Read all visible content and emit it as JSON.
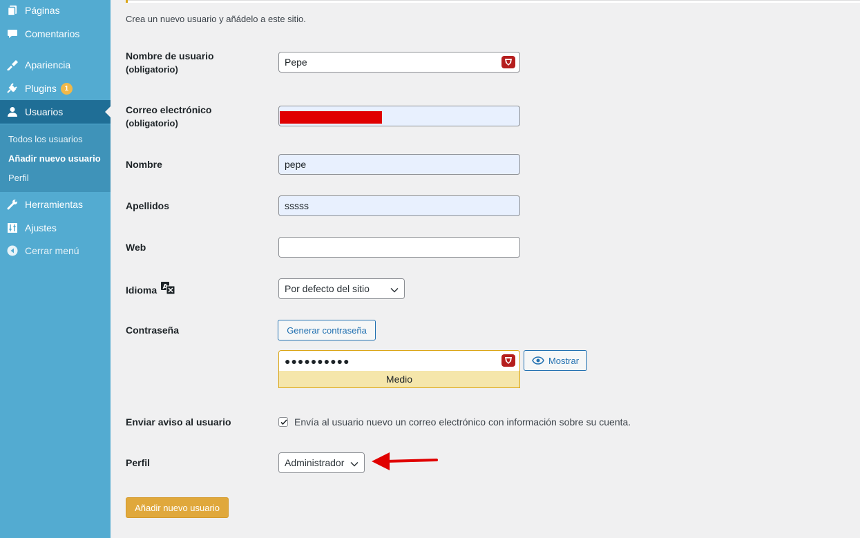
{
  "sidebar": {
    "items": [
      {
        "label": "Páginas",
        "icon": "pages-icon"
      },
      {
        "label": "Comentarios",
        "icon": "comments-icon"
      },
      {
        "label": "Apariencia",
        "icon": "appearance-icon"
      },
      {
        "label": "Plugins",
        "icon": "plugins-icon",
        "badge": "1"
      },
      {
        "label": "Usuarios",
        "icon": "users-icon"
      },
      {
        "label": "Herramientas",
        "icon": "tools-icon"
      },
      {
        "label": "Ajustes",
        "icon": "settings-icon"
      },
      {
        "label": "Cerrar menú",
        "icon": "collapse-icon"
      }
    ],
    "submenu": [
      "Todos los usuarios",
      "Añadir nuevo usuario",
      "Perfil"
    ],
    "colors": {
      "background": "#53abd1",
      "current": "#1f6e96",
      "submenu": "#3f93b9",
      "badge": "#f0b849"
    }
  },
  "form": {
    "intro": "Crea un nuevo usuario y añádelo a este sitio.",
    "username": {
      "label": "Nombre de usuario",
      "required": "(obligatorio)",
      "value": "Pepe"
    },
    "email": {
      "label": "Correo electrónico",
      "required": "(obligatorio)",
      "value": ""
    },
    "first_name": {
      "label": "Nombre",
      "value": "pepe"
    },
    "last_name": {
      "label": "Apellidos",
      "value": "sssss"
    },
    "website": {
      "label": "Web",
      "value": ""
    },
    "language": {
      "label": "Idioma",
      "value": "Por defecto del sitio"
    },
    "password": {
      "label": "Contraseña",
      "generate_button": "Generar contraseña",
      "value": "●●●●●●●●●●",
      "show_button": "Mostrar",
      "strength": "Medio"
    },
    "notify": {
      "label": "Enviar aviso al usuario",
      "checked": true,
      "text": "Envía al usuario nuevo un correo electrónico con información sobre su cuenta."
    },
    "role": {
      "label": "Perfil",
      "value": "Administrador"
    },
    "submit": "Añadir nuevo usuario"
  },
  "colors": {
    "primary_button": "#e0a83c",
    "link": "#2271b1",
    "strength_bg": "#f5e6ab",
    "arrow": "#e00000"
  }
}
